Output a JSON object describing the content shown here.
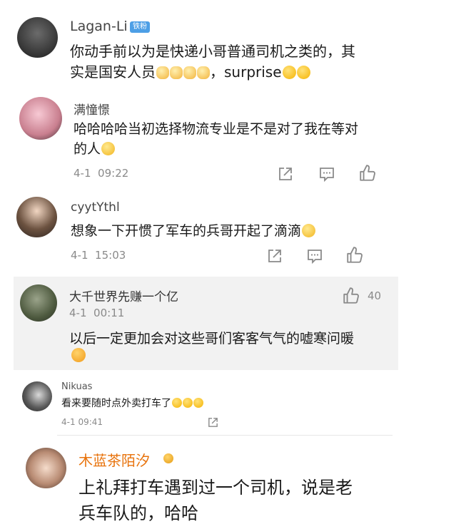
{
  "comments": [
    {
      "username": "Lagan-Li",
      "badge": "铁粉",
      "text_line1": "你动手前以为是快递小哥普通司机之类的，其",
      "text_line2": "实是国安人员",
      "text_line2_suffix": "，surprise"
    },
    {
      "username": "满憧憬",
      "text_line1": "哈哈哈哈当初选择物流专业是不是对了我在等对",
      "text_line2": "的人",
      "date": "4-1",
      "time": "09:22"
    },
    {
      "username": "cyytYthl",
      "text_line1": "想象一下开惯了军车的兵哥开起了滴滴",
      "date": "4-1",
      "time": "15:03"
    },
    {
      "username": "大千世界先赚一个亿",
      "like_count": "40",
      "date": "4-1",
      "time": "00:11",
      "text_line1": "以后一定更加会对这些哥们客客气气的嘘寒问暖"
    },
    {
      "username": "Nikuas",
      "text_line1": "看来要随时点外卖打车了",
      "date": "4-1",
      "time": "09:41"
    },
    {
      "username": "木蓝茶陌汐",
      "text_line1": "上礼拜打车遇到过一个司机，说是老",
      "text_line2": "兵车队的，哈哈"
    }
  ],
  "icons": {
    "share": "share-icon",
    "comment": "comment-icon",
    "like": "like-icon"
  },
  "colors": {
    "username_vip": "#e8730c",
    "badge": "#4d9fe6",
    "meta_gray": "#8a8a8a",
    "highlight_bg": "#f2f2f2"
  }
}
